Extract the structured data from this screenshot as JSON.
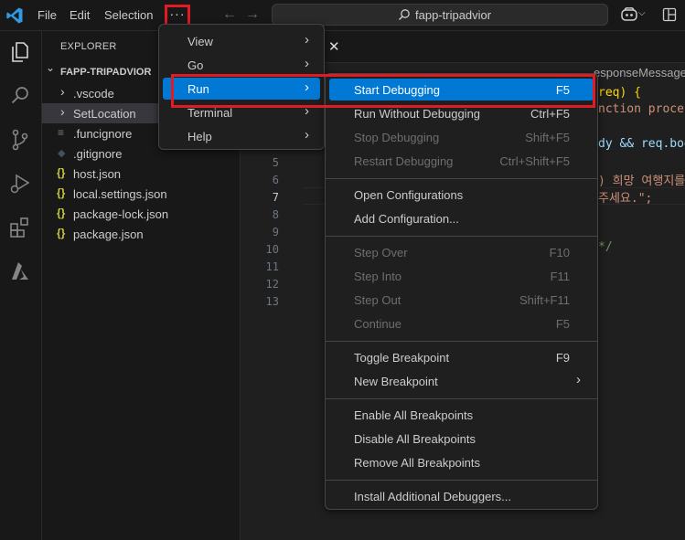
{
  "titlebar": {
    "menus": [
      "File",
      "Edit",
      "Selection"
    ],
    "more_label": "···",
    "search_text": "fapp-tripadvior",
    "back_arrow": "←",
    "forward_arrow": "→",
    "copilot_chevron": "⌵"
  },
  "sidebar": {
    "title": "EXPLORER",
    "folder": "FAPP-TRIPADVIOR",
    "folder_chevron": "⌄",
    "items": [
      {
        "label": ".vscode",
        "icon": "chevron-right-icon",
        "glyph": "›",
        "color": "#cccccc"
      },
      {
        "label": "SetLocation",
        "icon": "chevron-right-icon",
        "glyph": "›",
        "color": "#cccccc"
      },
      {
        "label": ".funcignore",
        "icon": "lines-file-icon",
        "glyph": "≡",
        "color": "#6d8086"
      },
      {
        "label": ".gitignore",
        "icon": "git-file-icon",
        "glyph": "◆",
        "color": "#41535b"
      },
      {
        "label": "host.json",
        "icon": "json-file-icon",
        "glyph": "{}",
        "color": "#cbcb41"
      },
      {
        "label": "local.settings.json",
        "icon": "json-file-icon",
        "glyph": "{}",
        "color": "#cbcb41"
      },
      {
        "label": "package-lock.json",
        "icon": "json-file-icon",
        "glyph": "{}",
        "color": "#cbcb41"
      },
      {
        "label": "package.json",
        "icon": "json-file-icon",
        "glyph": "{}",
        "color": "#cbcb41"
      }
    ]
  },
  "editor": {
    "tab_close": "✕",
    "breadcrumb": "esponseMessage",
    "line_numbers": [
      "5",
      "6",
      "7",
      "8",
      "9",
      "10",
      "11",
      "12",
      "13"
    ],
    "active_line": "7",
    "code_fragments": [
      {
        "text": "req) {",
        "color": "#ffd700"
      },
      {
        "text": "nction proces",
        "color": "#ce9178"
      },
      {
        "text": "dy && req.bod",
        "color": "#9cdcfe"
      },
      {
        "text": ") 희망 여행지를",
        "color": "#ce9178"
      },
      {
        "text": "주세요.\";",
        "color": "#ce9178"
      },
      {
        "text": "*/",
        "color": "#6a9955"
      }
    ]
  },
  "menu_main": {
    "items": [
      {
        "label": "View",
        "arrow": "›"
      },
      {
        "label": "Go",
        "arrow": "›"
      },
      {
        "label": "Run",
        "arrow": "›",
        "highlighted": true
      },
      {
        "label": "Terminal",
        "arrow": "›"
      },
      {
        "label": "Help",
        "arrow": "›"
      }
    ]
  },
  "menu_run": {
    "items": [
      {
        "label": "Start Debugging",
        "key": "F5",
        "highlighted": true
      },
      {
        "label": "Run Without Debugging",
        "key": "Ctrl+F5"
      },
      {
        "label": "Stop Debugging",
        "key": "Shift+F5",
        "disabled": true
      },
      {
        "label": "Restart Debugging",
        "key": "Ctrl+Shift+F5",
        "disabled": true
      },
      {
        "label": "Open Configurations",
        "key": ""
      },
      {
        "label": "Add Configuration...",
        "key": ""
      },
      {
        "label": "Step Over",
        "key": "F10",
        "disabled": true
      },
      {
        "label": "Step Into",
        "key": "F11",
        "disabled": true
      },
      {
        "label": "Step Out",
        "key": "Shift+F11",
        "disabled": true
      },
      {
        "label": "Continue",
        "key": "F5",
        "disabled": true
      },
      {
        "label": "Toggle Breakpoint",
        "key": "F9"
      },
      {
        "label": "New Breakpoint",
        "key": "",
        "arrow": "›"
      },
      {
        "label": "Enable All Breakpoints",
        "key": ""
      },
      {
        "label": "Disable All Breakpoints",
        "key": ""
      },
      {
        "label": "Remove All Breakpoints",
        "key": ""
      },
      {
        "label": "Install Additional Debuggers...",
        "key": ""
      }
    ]
  },
  "colors": {
    "highlight": "#0078d4",
    "annotation_red": "#e01b24",
    "vscode_blue": "#2f9ae6"
  }
}
